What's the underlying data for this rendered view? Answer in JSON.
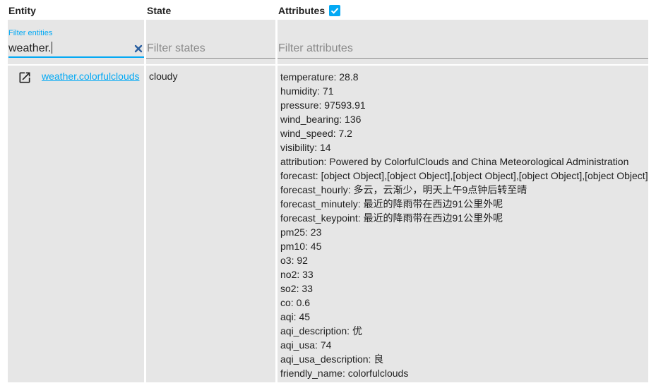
{
  "header": {
    "entity_label": "Entity",
    "state_label": "State",
    "attributes_label": "Attributes",
    "attributes_checked": true
  },
  "filters": {
    "entity_label": "Filter entities",
    "entity_value": "weather.",
    "state_placeholder": "Filter states",
    "attributes_placeholder": "Filter attributes"
  },
  "rows": [
    {
      "entity_id": "weather.colorfulclouds",
      "state": "cloudy",
      "attributes": [
        "temperature: 28.8",
        "humidity: 71",
        "pressure: 97593.91",
        "wind_bearing: 136",
        "wind_speed: 7.2",
        "visibility: 14",
        "attribution: Powered by ColorfulClouds and China Meteorological Administration",
        "forecast: [object Object],[object Object],[object Object],[object Object],[object Object]",
        "forecast_hourly: 多云，云渐少，明天上午9点钟后转至晴",
        "forecast_minutely: 最近的降雨带在西边91公里外呢",
        "forecast_keypoint: 最近的降雨带在西边91公里外呢",
        "pm25: 23",
        "pm10: 45",
        "o3: 92",
        "no2: 33",
        "so2: 33",
        "co: 0.6",
        "aqi: 45",
        "aqi_description: 优",
        "aqi_usa: 74",
        "aqi_usa_description: 良",
        "friendly_name: colorfulclouds"
      ]
    }
  ],
  "colors": {
    "accent": "#03a9f4",
    "column_background": "#e6e6e6",
    "clear_icon": "#2a5fa0"
  },
  "icons": {
    "clear": "close-icon",
    "open": "open-in-new-icon",
    "checkbox": "check-icon"
  }
}
